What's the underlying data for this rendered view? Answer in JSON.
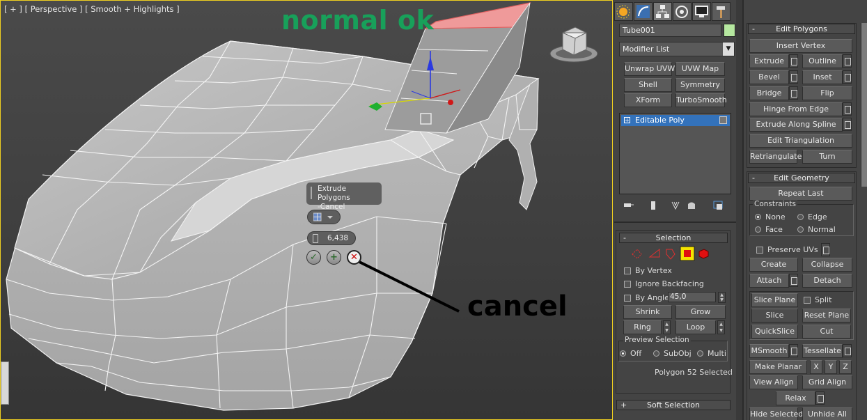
{
  "viewport": {
    "label": "[ + ] [ Perspective ] [ Smooth + Highlights ]",
    "annotation_top": "normal ok",
    "annotation_cancel": "cancel",
    "caddy": {
      "title": "Extrude Polygons -Cancel",
      "amount": "6,438"
    }
  },
  "command_panel": {
    "tab_icons": [
      "sun-icon",
      "arc-icon",
      "hierarchy-icon",
      "motion-icon",
      "display-icon",
      "hammer-icon"
    ],
    "object_name": "Tube001",
    "object_color": "#b6e8a0",
    "modifier_list": "Modifier List",
    "modifier_buttons": [
      "Unwrap UVW",
      "UVW Map",
      "Shell",
      "Symmetry",
      "XForm",
      "TurboSmooth"
    ],
    "stack_item": "Editable Poly",
    "selection": {
      "title": "Selection",
      "by_vertex": "By Vertex",
      "ignore_backfacing": "Ignore Backfacing",
      "by_angle": "By Angle:",
      "angle_value": "45,0",
      "shrink": "Shrink",
      "grow": "Grow",
      "ring": "Ring",
      "loop": "Loop",
      "preview_title": "Preview Selection",
      "preview_off": "Off",
      "preview_subobj": "SubObj",
      "preview_multi": "Multi",
      "status": "Polygon 52 Selected"
    },
    "soft_selection": "Soft Selection"
  },
  "edit_polygons": {
    "title": "Edit Polygons",
    "insert_vertex": "Insert Vertex",
    "extrude": "Extrude",
    "outline": "Outline",
    "bevel": "Bevel",
    "inset": "Inset",
    "bridge": "Bridge",
    "flip": "Flip",
    "hinge": "Hinge From Edge",
    "extrude_spline": "Extrude Along Spline",
    "edit_tri": "Edit Triangulation",
    "retriangulate": "Retriangulate",
    "turn": "Turn"
  },
  "edit_geometry": {
    "title": "Edit Geometry",
    "repeat_last": "Repeat Last",
    "constraints": "Constraints",
    "none": "None",
    "edge": "Edge",
    "face": "Face",
    "normal": "Normal",
    "preserve_uvs": "Preserve UVs",
    "create": "Create",
    "collapse": "Collapse",
    "attach": "Attach",
    "detach": "Detach",
    "slice_plane": "Slice Plane",
    "split": "Split",
    "slice": "Slice",
    "reset_plane": "Reset Plane",
    "quickslice": "QuickSlice",
    "cut": "Cut",
    "msmooth": "MSmooth",
    "tessellate": "Tessellate",
    "make_planar": "Make Planar",
    "x": "X",
    "y": "Y",
    "z": "Z",
    "view_align": "View Align",
    "grid_align": "Grid Align",
    "relax": "Relax",
    "hide_selected": "Hide Selected",
    "unhide_all": "Unhide All"
  }
}
